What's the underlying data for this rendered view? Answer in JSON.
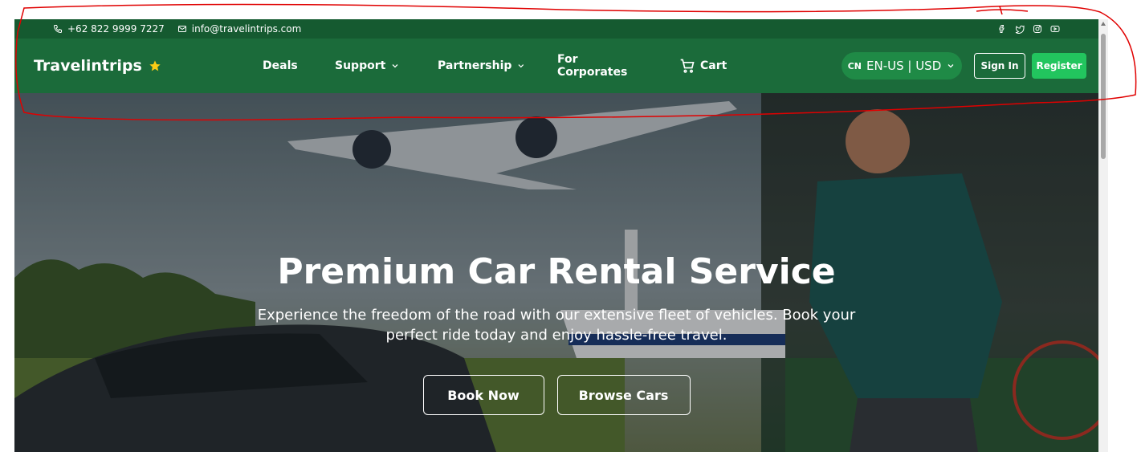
{
  "topbar": {
    "phone": "+62 822 9999 7227",
    "email": "info@travelintrips.com",
    "social_icons": [
      "facebook-icon",
      "twitter-icon",
      "instagram-icon",
      "youtube-icon"
    ]
  },
  "navbar": {
    "brand": "Travelintrips",
    "links": {
      "deals": "Deals",
      "support": "Support",
      "partnership": "Partnership",
      "corporates": "For Corporates",
      "cart": "Cart"
    },
    "language": {
      "flag": "CN",
      "label": "EN-US | USD"
    },
    "signin": "Sign In",
    "register": "Register"
  },
  "hero": {
    "title": "Premium Car Rental Service",
    "subtitle": "Experience the freedom of the road with our extensive fleet of vehicles. Book your perfect ride today and enjoy hassle-free travel.",
    "book_now": "Book Now",
    "browse_cars": "Browse Cars"
  },
  "colors": {
    "topbar": "#155a30",
    "navbar": "#1b6b3a",
    "register": "#22c55e",
    "annotation": "#e00000"
  }
}
